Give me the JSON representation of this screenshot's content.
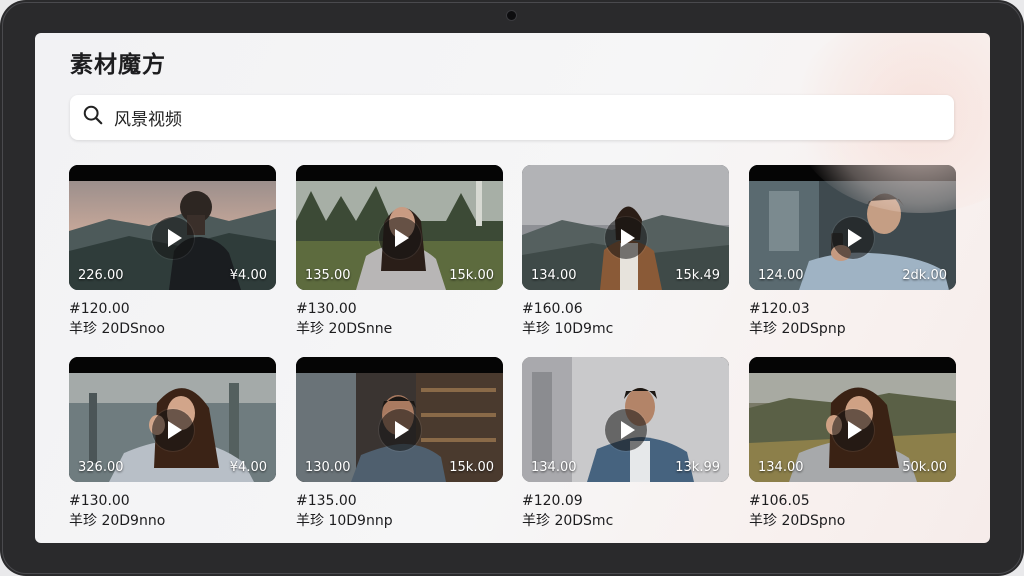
{
  "app": {
    "title": "素材魔方"
  },
  "search": {
    "value": "风景视频",
    "icon": "search-icon"
  },
  "videos": [
    {
      "left": "226.00",
      "right": "¥4.00",
      "title": "#120.00",
      "subtitle": "羊珍 20DSnoo"
    },
    {
      "left": "135.00",
      "right": "15k.00",
      "title": "#130.00",
      "subtitle": "羊珍 20DSnne"
    },
    {
      "left": "134.00",
      "right": "15k.49",
      "title": "#160.06",
      "subtitle": "羊珍 10D9mc"
    },
    {
      "left": "124.00",
      "right": "2dk.00",
      "title": "#120.03",
      "subtitle": "羊珍 20DSpnp"
    },
    {
      "left": "326.00",
      "right": "¥4.00",
      "title": "#130.00",
      "subtitle": "羊珍 20D9nno"
    },
    {
      "left": "130.00",
      "right": "15k.00",
      "title": "#135.00",
      "subtitle": "羊珍 10D9nnp"
    },
    {
      "left": "134.00",
      "right": "13k.99",
      "title": "#120.09",
      "subtitle": "羊珍 20DSmc"
    },
    {
      "left": "134.00",
      "right": "50k.00",
      "title": "#106.05",
      "subtitle": "羊珍 20DSpno"
    }
  ]
}
